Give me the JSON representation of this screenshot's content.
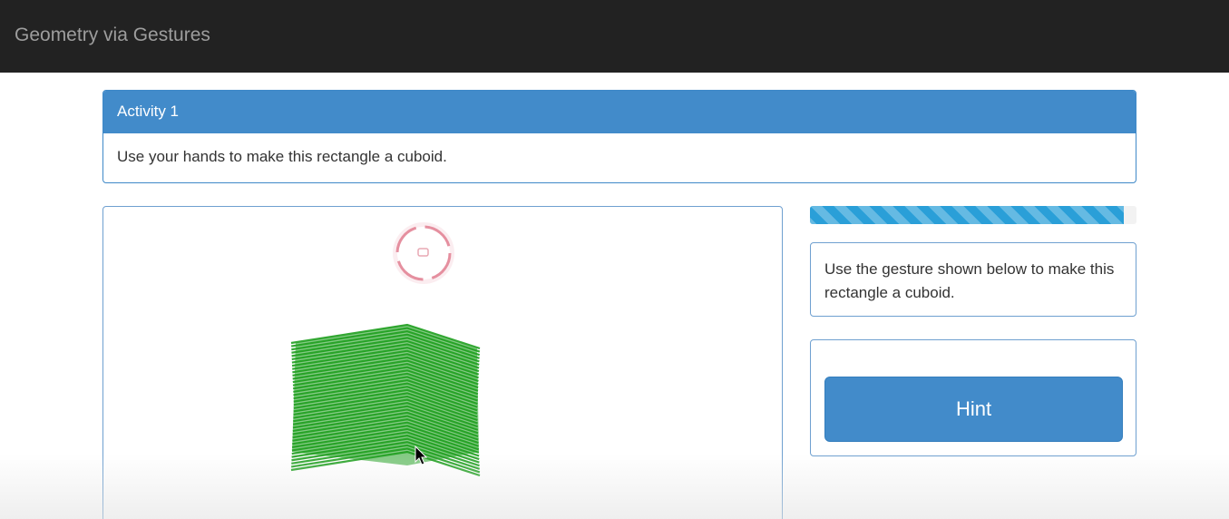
{
  "app": {
    "title": "Geometry via Gestures"
  },
  "activity": {
    "heading": "Activity 1",
    "body": "Use your hands to make this rectangle a cuboid."
  },
  "progress": {
    "value_fraction": 0.96,
    "color": "#2a9fd8"
  },
  "instruction": {
    "text": "Use the gesture shown below to make this rectangle a cuboid."
  },
  "hint": {
    "label": "Hint"
  },
  "canvas": {
    "shape_color": "#1e9e1e",
    "icons": [
      "hand-tracker-ring-icon",
      "mouse-cursor-icon"
    ]
  },
  "colors": {
    "navbar": "#222222",
    "primary": "#428bca"
  }
}
